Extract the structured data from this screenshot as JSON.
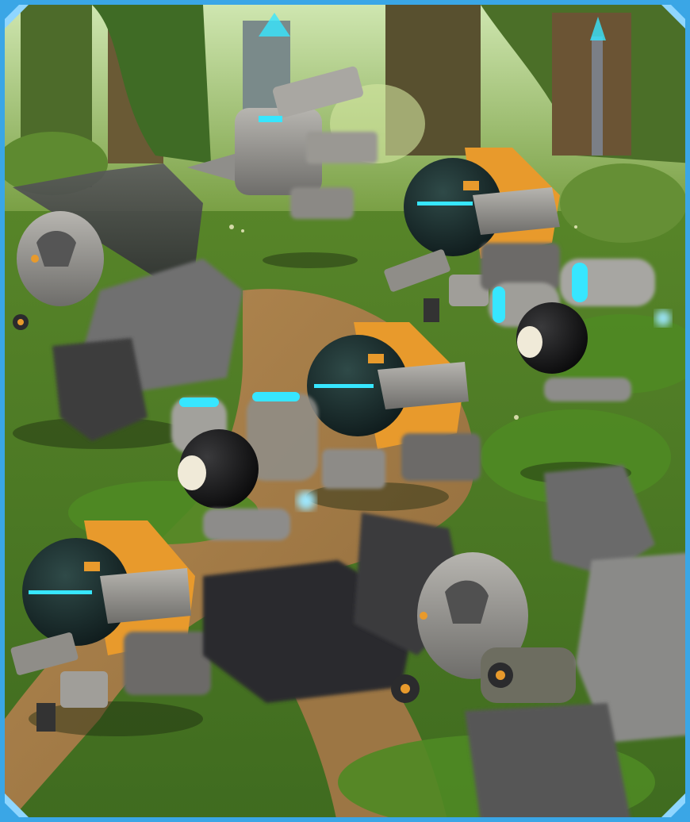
{
  "scene": {
    "kind": "game-battle-artwork",
    "environment": "jungle-clearing",
    "units": [
      "heavy-shield-mech",
      "drill-drone",
      "round-gunner-bot",
      "round-gunner-bot",
      "round-gunner-bot",
      "twin-cannon-bot",
      "twin-cannon-bot",
      "heavy-shield-mech"
    ]
  },
  "colors": {
    "frame_border": "#3aa6e6",
    "frame_highlight": "#8fd6ff",
    "accent_cyan": "#37e6ff",
    "accent_orange": "#e89a2c",
    "armor_gray": "#8d8c8a",
    "jungle_green": "#5d8a2b",
    "dirt_path": "#a67c48"
  }
}
